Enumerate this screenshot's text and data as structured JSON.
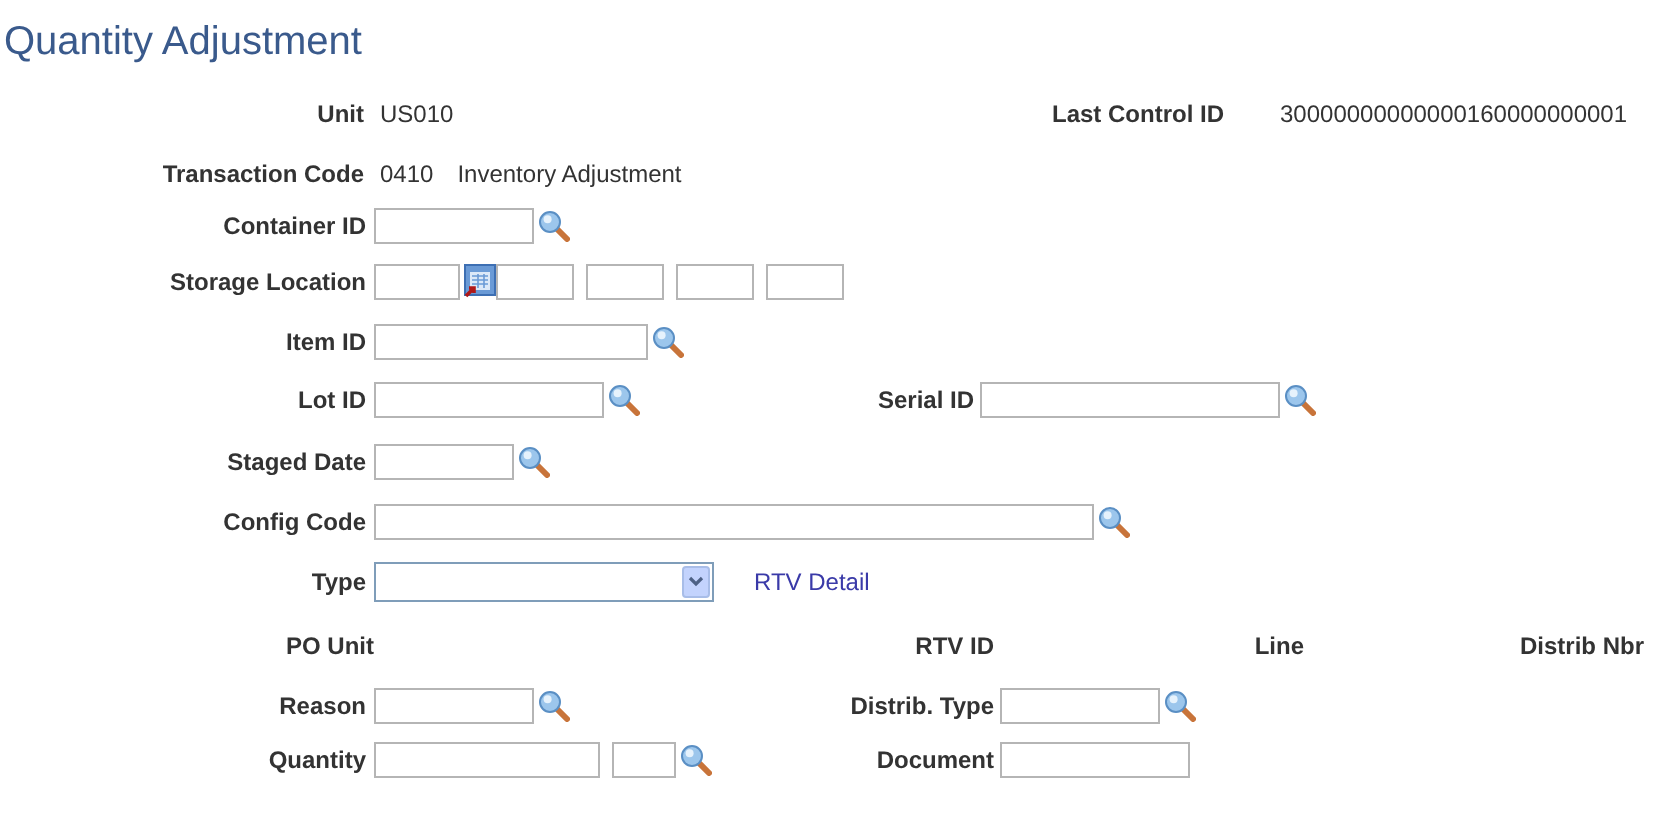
{
  "title": "Quantity Adjustment",
  "rows": [
    {
      "kind": "display",
      "label": "Unit",
      "value": "US010",
      "right": {
        "label": "Last Control ID",
        "value": "30000000000000160000000001"
      }
    },
    {
      "kind": "display",
      "label": "Transaction Code",
      "value": "0410",
      "description": "Inventory Adjustment"
    },
    {
      "kind": "fields",
      "label": "Container ID",
      "fields": [
        {
          "kind": "lookup"
        }
      ]
    },
    {
      "kind": "fields",
      "label": "Storage Location",
      "fields": [
        {
          "kind": "prompt"
        },
        {
          "kind": "text"
        },
        {
          "kind": "text"
        },
        {
          "kind": "text"
        },
        {
          "kind": "text"
        }
      ]
    },
    {
      "kind": "fields",
      "label": "Item ID",
      "fields": [
        {
          "kind": "lookup"
        }
      ]
    },
    {
      "kind": "fields",
      "label": "Lot ID",
      "fields": [
        {
          "kind": "lookup"
        }
      ],
      "right": {
        "label": "Serial ID",
        "fields": [
          {
            "kind": "lookup"
          }
        ]
      }
    },
    {
      "kind": "fields",
      "label": "Staged Date",
      "fields": [
        {
          "kind": "lookup"
        }
      ]
    },
    {
      "kind": "fields",
      "label": "Config Code",
      "fields": [
        {
          "kind": "lookup"
        }
      ]
    },
    {
      "kind": "fields",
      "label": "Type",
      "fields": [
        {
          "kind": "select"
        }
      ],
      "link": "RTV Detail"
    },
    {
      "kind": "headers",
      "labels": [
        "PO Unit",
        "RTV ID",
        "Line",
        "Distrib Nbr"
      ]
    },
    {
      "kind": "fields",
      "label": "Reason",
      "fields": [
        {
          "kind": "lookup"
        }
      ],
      "right": {
        "label": "Distrib. Type",
        "fields": [
          {
            "kind": "lookup"
          }
        ]
      }
    },
    {
      "kind": "fields",
      "label": "Quantity",
      "fields": [
        {
          "kind": "text"
        },
        {
          "kind": "lookup"
        }
      ],
      "right": {
        "label": "Document",
        "fields": [
          {
            "kind": "text"
          }
        ]
      }
    }
  ]
}
